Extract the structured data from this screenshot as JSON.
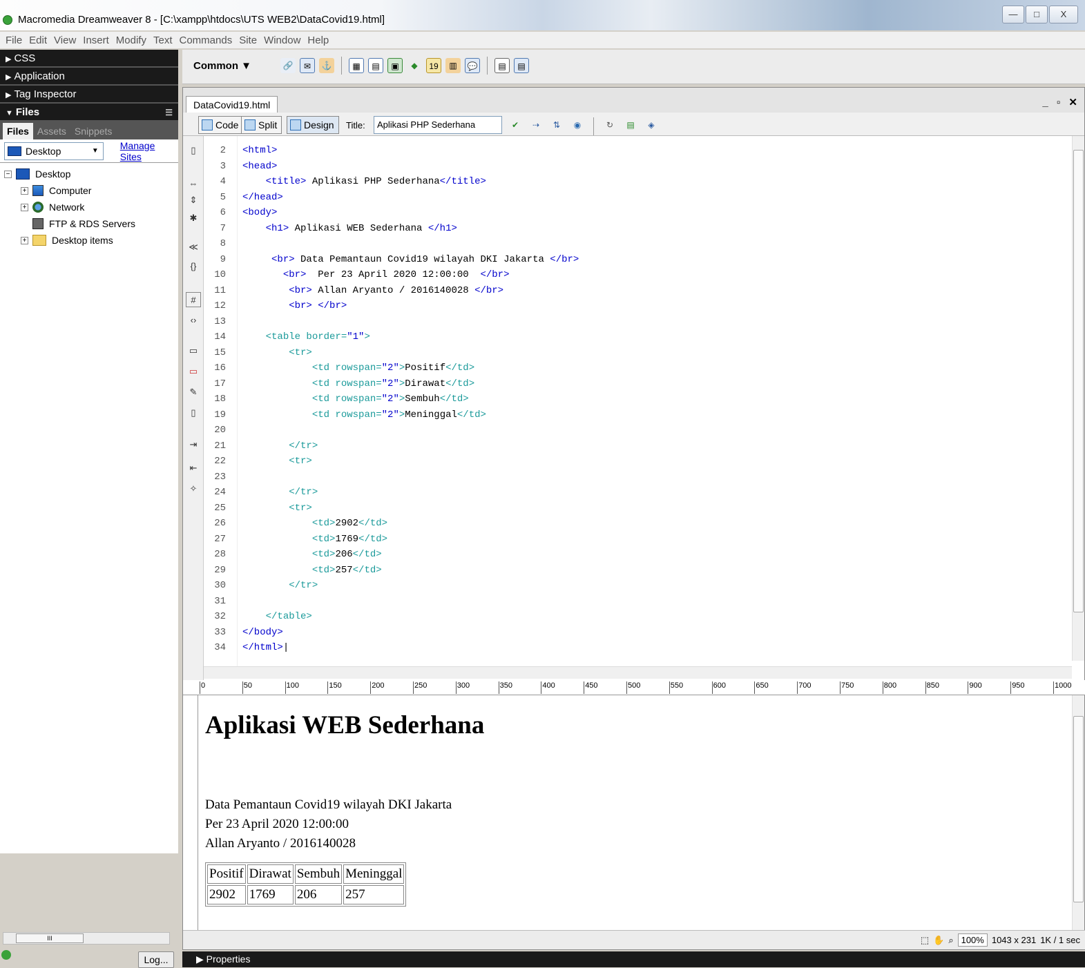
{
  "window": {
    "title": "Macromedia Dreamweaver 8 - [C:\\xampp\\htdocs\\UTS WEB2\\DataCovid19.html]",
    "controls": [
      "—",
      "□",
      "X"
    ]
  },
  "menu": [
    "File",
    "Edit",
    "View",
    "Insert",
    "Modify",
    "Text",
    "Commands",
    "Site",
    "Window",
    "Help"
  ],
  "panels": {
    "css": "CSS",
    "application": "Application",
    "tag_inspector": "Tag Inspector",
    "files": "Files",
    "tabs": [
      "Files",
      "Assets",
      "Snippets"
    ],
    "site": "Desktop",
    "manage_sites": "Manage Sites",
    "tree": [
      {
        "label": "Desktop",
        "icon": "monitor-icon",
        "indent": 0,
        "expander": "−"
      },
      {
        "label": "Computer",
        "icon": "computer-icon",
        "indent": 1,
        "expander": "+"
      },
      {
        "label": "Network",
        "icon": "network-icon",
        "indent": 1,
        "expander": "+"
      },
      {
        "label": "FTP & RDS Servers",
        "icon": "server-icon",
        "indent": 1,
        "expander": ""
      },
      {
        "label": "Desktop items",
        "icon": "folder-icon",
        "indent": 1,
        "expander": "+"
      }
    ],
    "log_button": "Log..."
  },
  "insert_bar": {
    "category": "Common ▼"
  },
  "document": {
    "tab": "DataCovid19.html",
    "views": {
      "code": "Code",
      "split": "Split",
      "design": "Design"
    },
    "title_label": "Title:",
    "title_value": "Aplikasi PHP Sederhana"
  },
  "code_lines": [
    {
      "n": "2",
      "html": "<span class=\"tg\">&lt;html&gt;</span>"
    },
    {
      "n": "3",
      "html": "<span class=\"tg\">&lt;head&gt;</span>"
    },
    {
      "n": "4",
      "html": "    <span class=\"tg\">&lt;title&gt;</span> Aplikasi PHP Sederhana<span class=\"tg\">&lt;/title&gt;</span>"
    },
    {
      "n": "5",
      "html": "<span class=\"tg\">&lt;/head&gt;</span>"
    },
    {
      "n": "6",
      "html": "<span class=\"tg\">&lt;body&gt;</span>"
    },
    {
      "n": "7",
      "html": "    <span class=\"tg\">&lt;h1&gt;</span> Aplikasi WEB Sederhana <span class=\"tg\">&lt;/h1&gt;</span>"
    },
    {
      "n": "8",
      "html": ""
    },
    {
      "n": "9",
      "html": "     <span class=\"tg\">&lt;br&gt;</span> Data Pemantaun Covid19 wilayah DKI Jakarta <span class=\"tg\">&lt;/br&gt;</span>"
    },
    {
      "n": "10",
      "html": "       <span class=\"tg\">&lt;br&gt;</span>  Per 23 April 2020 12:00:00  <span class=\"tg\">&lt;/br&gt;</span>"
    },
    {
      "n": "11",
      "html": "        <span class=\"tg\">&lt;br&gt;</span> Allan Aryanto / 2016140028 <span class=\"tg\">&lt;/br&gt;</span>"
    },
    {
      "n": "12",
      "html": "        <span class=\"tg\">&lt;br&gt;</span> <span class=\"tg\">&lt;/br&gt;</span>"
    },
    {
      "n": "13",
      "html": ""
    },
    {
      "n": "14",
      "html": "    <span class=\"tl\">&lt;table border=</span><span class=\"av\">\"1\"</span><span class=\"tl\">&gt;</span>"
    },
    {
      "n": "15",
      "html": "        <span class=\"tl\">&lt;tr&gt;</span>"
    },
    {
      "n": "16",
      "html": "            <span class=\"tl\">&lt;td rowspan=</span><span class=\"av\">\"2\"</span><span class=\"tl\">&gt;</span>Positif<span class=\"tl\">&lt;/td&gt;</span>"
    },
    {
      "n": "17",
      "html": "            <span class=\"tl\">&lt;td rowspan=</span><span class=\"av\">\"2\"</span><span class=\"tl\">&gt;</span>Dirawat<span class=\"tl\">&lt;/td&gt;</span>"
    },
    {
      "n": "18",
      "html": "            <span class=\"tl\">&lt;td rowspan=</span><span class=\"av\">\"2\"</span><span class=\"tl\">&gt;</span>Sembuh<span class=\"tl\">&lt;/td&gt;</span>"
    },
    {
      "n": "19",
      "html": "            <span class=\"tl\">&lt;td rowspan=</span><span class=\"av\">\"2\"</span><span class=\"tl\">&gt;</span>Meninggal<span class=\"tl\">&lt;/td&gt;</span>"
    },
    {
      "n": "20",
      "html": ""
    },
    {
      "n": "21",
      "html": "        <span class=\"tl\">&lt;/tr&gt;</span>"
    },
    {
      "n": "22",
      "html": "        <span class=\"tl\">&lt;tr&gt;</span>"
    },
    {
      "n": "23",
      "html": ""
    },
    {
      "n": "24",
      "html": "        <span class=\"tl\">&lt;/tr&gt;</span>"
    },
    {
      "n": "25",
      "html": "        <span class=\"tl\">&lt;tr&gt;</span>"
    },
    {
      "n": "26",
      "html": "            <span class=\"tl\">&lt;td&gt;</span>2902<span class=\"tl\">&lt;/td&gt;</span>"
    },
    {
      "n": "27",
      "html": "            <span class=\"tl\">&lt;td&gt;</span>1769<span class=\"tl\">&lt;/td&gt;</span>"
    },
    {
      "n": "28",
      "html": "            <span class=\"tl\">&lt;td&gt;</span>206<span class=\"tl\">&lt;/td&gt;</span>"
    },
    {
      "n": "29",
      "html": "            <span class=\"tl\">&lt;td&gt;</span>257<span class=\"tl\">&lt;/td&gt;</span>"
    },
    {
      "n": "30",
      "html": "        <span class=\"tl\">&lt;/tr&gt;</span>"
    },
    {
      "n": "31",
      "html": ""
    },
    {
      "n": "32",
      "html": "    <span class=\"tl\">&lt;/table&gt;</span>"
    },
    {
      "n": "33",
      "html": "<span class=\"tg\">&lt;/body&gt;</span>"
    },
    {
      "n": "34",
      "html": "<span class=\"tg\">&lt;/html&gt;</span>|"
    }
  ],
  "ruler_labels": [
    "0",
    "50",
    "100",
    "150",
    "200",
    "250",
    "300",
    "350",
    "400",
    "450",
    "500",
    "550",
    "600",
    "650",
    "700",
    "750",
    "800",
    "850",
    "900",
    "950",
    "1000"
  ],
  "design": {
    "h1": "Aplikasi WEB Sederhana",
    "line1": "Data Pemantaun Covid19 wilayah DKI Jakarta",
    "line2": "Per 23 April 2020 12:00:00",
    "line3": "Allan Aryanto / 2016140028",
    "table_head": [
      "Positif",
      "Dirawat",
      "Sembuh",
      "Meninggal"
    ],
    "table_row": [
      "2902",
      "1769",
      "206",
      "257"
    ]
  },
  "status": {
    "zoom": "100%",
    "size": "1043 x 231",
    "weight": "1K / 1 sec"
  },
  "properties": "Properties"
}
